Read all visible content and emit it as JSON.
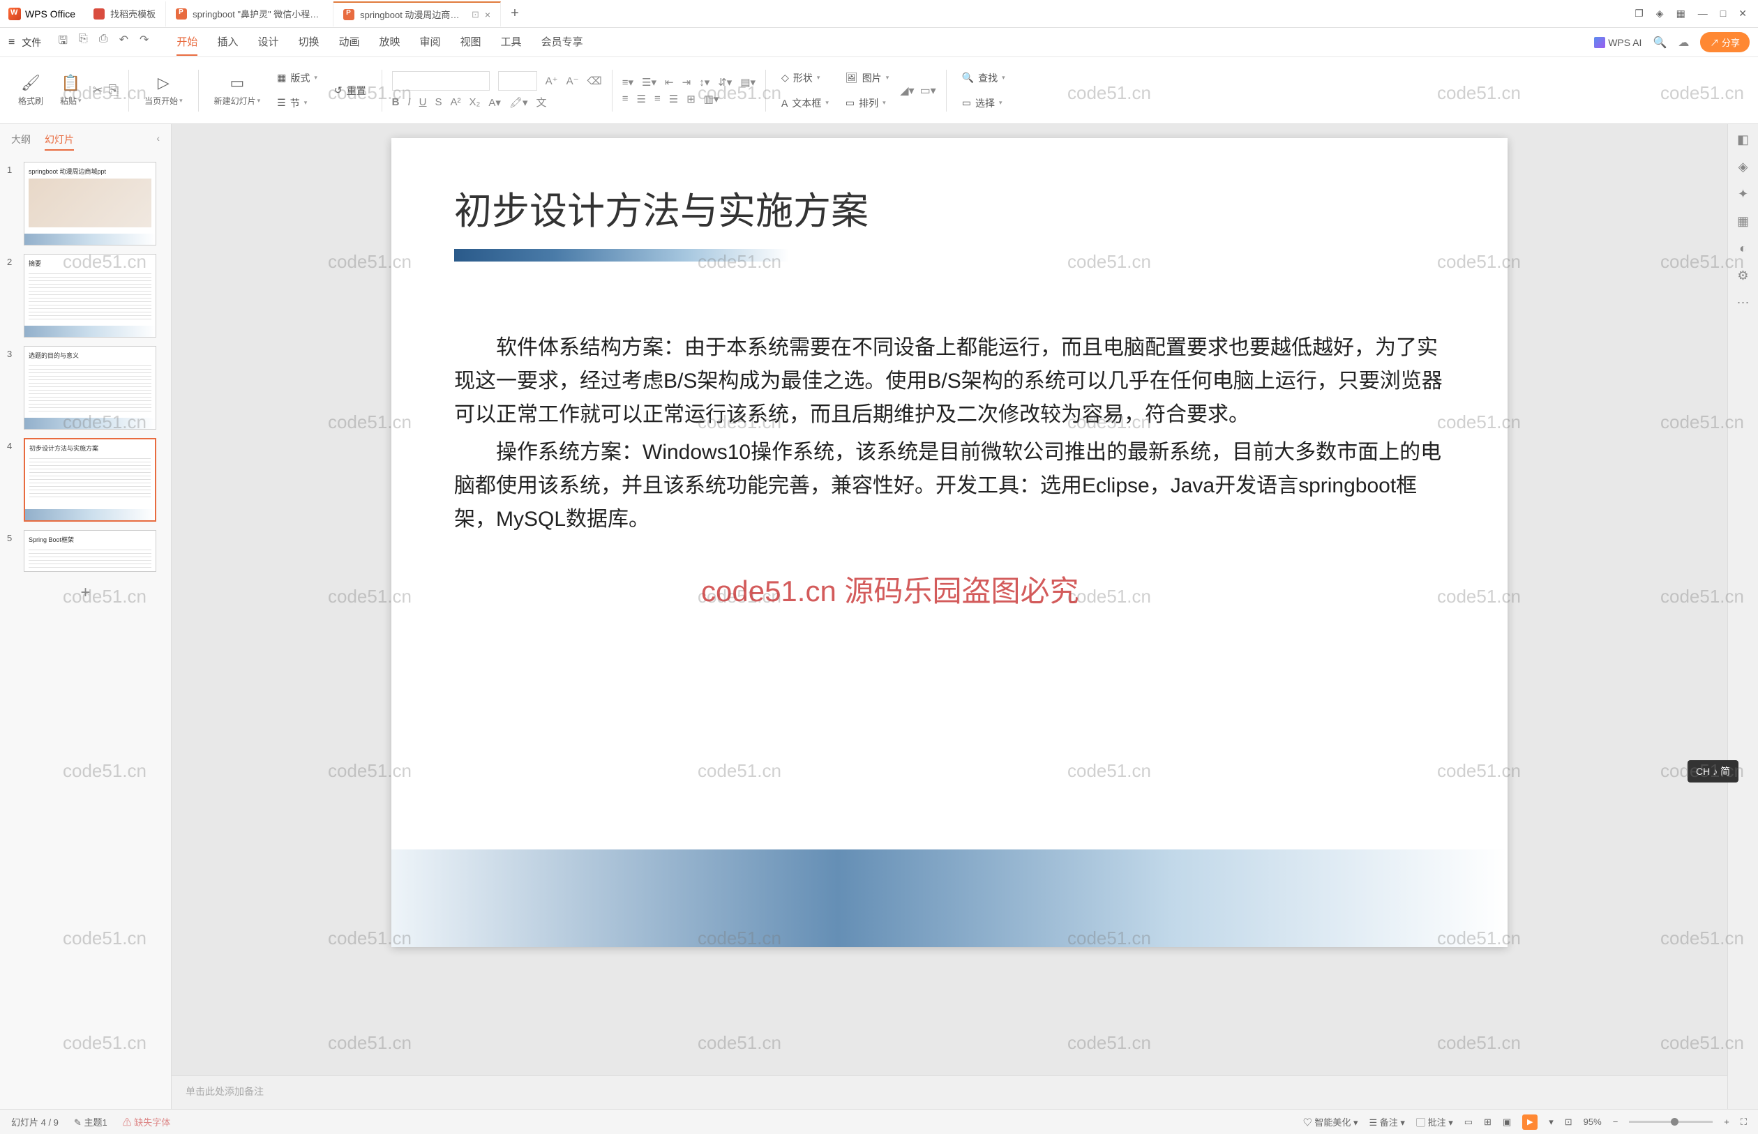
{
  "app": {
    "name": "WPS Office"
  },
  "tabs": [
    {
      "label": "找稻壳模板",
      "icon": "red"
    },
    {
      "label": "springboot \"鼻护灵\" 微信小程序的",
      "icon": "orange"
    },
    {
      "label": "springboot 动漫周边商城的",
      "icon": "orange",
      "active": true
    }
  ],
  "menubar": {
    "file": "文件",
    "items": [
      "开始",
      "插入",
      "设计",
      "切换",
      "动画",
      "放映",
      "审阅",
      "视图",
      "工具",
      "会员专享"
    ],
    "active": "开始",
    "ai": "WPS AI",
    "share": "分享"
  },
  "ribbon": {
    "format": "格式刷",
    "paste": "粘贴",
    "current_page": "当页开始",
    "new_slide": "新建幻灯片",
    "layout": "版式",
    "reset": "重置",
    "section": "节",
    "shape": "形状",
    "picture": "图片",
    "textbox": "文本框",
    "arrange": "排列",
    "find": "查找",
    "select": "选择",
    "font_placeholder": "",
    "size_placeholder": "",
    "wen": "文"
  },
  "sidebar": {
    "tab_outline": "大纲",
    "tab_slides": "幻灯片",
    "thumbs": [
      {
        "num": "1",
        "title": "springboot 动漫周边商城ppt"
      },
      {
        "num": "2",
        "title": "摘要"
      },
      {
        "num": "3",
        "title": "选题的目的与意义"
      },
      {
        "num": "4",
        "title": "初步设计方法与实施方案",
        "selected": true
      },
      {
        "num": "5",
        "title": "Spring Boot框架"
      }
    ]
  },
  "slide": {
    "title": "初步设计方法与实施方案",
    "para1": "软件体系结构方案：由于本系统需要在不同设备上都能运行，而且电脑配置要求也要越低越好，为了实现这一要求，经过考虑B/S架构成为最佳之选。使用B/S架构的系统可以几乎在任何电脑上运行，只要浏览器可以正常工作就可以正常运行该系统，而且后期维护及二次修改较为容易，符合要求。",
    "para2": "操作系统方案：Windows10操作系统，该系统是目前微软公司推出的最新系统，目前大多数市面上的电脑都使用该系统，并且该系统功能完善，兼容性好。开发工具：选用Eclipse，Java开发语言springboot框架，MySQL数据库。"
  },
  "notes": {
    "placeholder": "单击此处添加备注"
  },
  "statusbar": {
    "slide_count": "幻灯片 4 / 9",
    "theme": "主题1",
    "missing_font": "缺失字体",
    "beautify": "智能美化",
    "notes": "备注",
    "comments": "批注",
    "zoom": "95%"
  },
  "ime": "CH ♪ 简",
  "watermark_text": "code51.cn",
  "watermark_red": "code51.cn 源码乐园盗图必究"
}
